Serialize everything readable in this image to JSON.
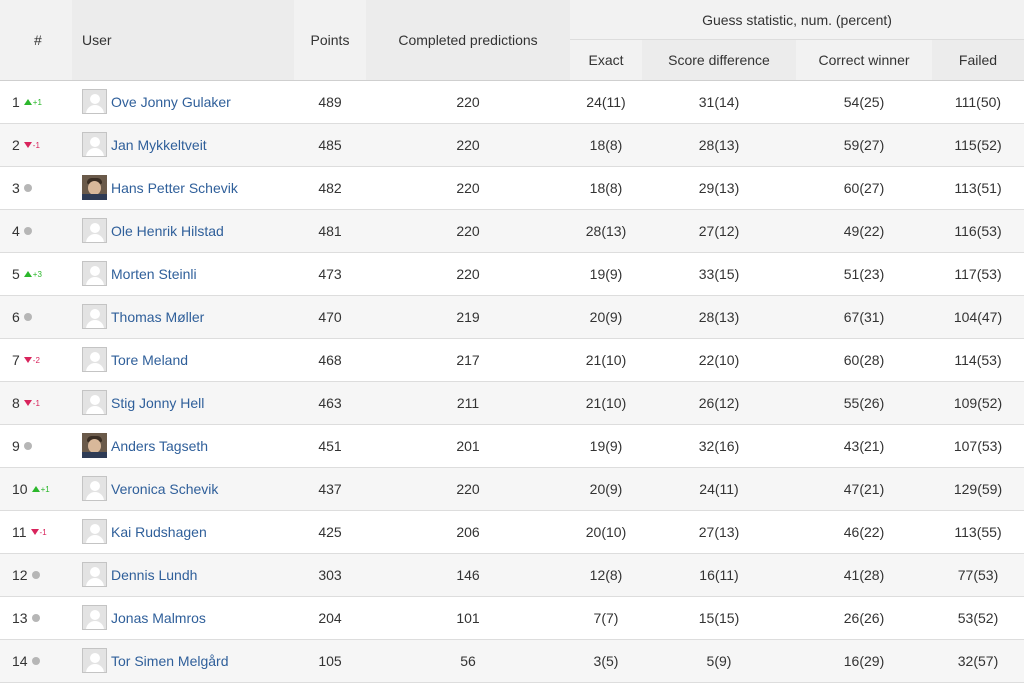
{
  "headers": {
    "rank": "#",
    "user": "User",
    "points": "Points",
    "completed": "Completed predictions",
    "group": "Guess statistic, num. (percent)",
    "exact": "Exact",
    "score_diff": "Score difference",
    "correct_winner": "Correct winner",
    "failed": "Failed"
  },
  "colors": {
    "up": "#2bb72b",
    "down": "#d8245c",
    "same": "#b6b6b6",
    "link": "#2f5f9a"
  },
  "rows": [
    {
      "rank": "1",
      "trend": "up",
      "delta": "+1",
      "avatar": "generic-avatar-icon",
      "name": "Ove Jonny Gulaker",
      "points": "489",
      "completed": "220",
      "exact": "24(11)",
      "score_diff": "31(14)",
      "correct_winner": "54(25)",
      "failed": "111(50)"
    },
    {
      "rank": "2",
      "trend": "down",
      "delta": "-1",
      "avatar": "generic-avatar-icon",
      "name": "Jan Mykkeltveit",
      "points": "485",
      "completed": "220",
      "exact": "18(8)",
      "score_diff": "28(13)",
      "correct_winner": "59(27)",
      "failed": "115(52)"
    },
    {
      "rank": "3",
      "trend": "same",
      "delta": "",
      "avatar": "photo-avatar",
      "name": "Hans Petter Schevik",
      "points": "482",
      "completed": "220",
      "exact": "18(8)",
      "score_diff": "29(13)",
      "correct_winner": "60(27)",
      "failed": "113(51)"
    },
    {
      "rank": "4",
      "trend": "same",
      "delta": "",
      "avatar": "generic-avatar-icon",
      "name": "Ole Henrik Hilstad",
      "points": "481",
      "completed": "220",
      "exact": "28(13)",
      "score_diff": "27(12)",
      "correct_winner": "49(22)",
      "failed": "116(53)"
    },
    {
      "rank": "5",
      "trend": "up",
      "delta": "+3",
      "avatar": "generic-avatar-icon",
      "name": "Morten Steinli",
      "points": "473",
      "completed": "220",
      "exact": "19(9)",
      "score_diff": "33(15)",
      "correct_winner": "51(23)",
      "failed": "117(53)"
    },
    {
      "rank": "6",
      "trend": "same",
      "delta": "",
      "avatar": "generic-avatar-icon",
      "name": "Thomas Møller",
      "points": "470",
      "completed": "219",
      "exact": "20(9)",
      "score_diff": "28(13)",
      "correct_winner": "67(31)",
      "failed": "104(47)"
    },
    {
      "rank": "7",
      "trend": "down",
      "delta": "-2",
      "avatar": "generic-avatar-icon",
      "name": "Tore Meland",
      "points": "468",
      "completed": "217",
      "exact": "21(10)",
      "score_diff": "22(10)",
      "correct_winner": "60(28)",
      "failed": "114(53)"
    },
    {
      "rank": "8",
      "trend": "down",
      "delta": "-1",
      "avatar": "generic-avatar-icon",
      "name": "Stig Jonny Hell",
      "points": "463",
      "completed": "211",
      "exact": "21(10)",
      "score_diff": "26(12)",
      "correct_winner": "55(26)",
      "failed": "109(52)"
    },
    {
      "rank": "9",
      "trend": "same",
      "delta": "",
      "avatar": "photo-avatar",
      "name": "Anders Tagseth",
      "points": "451",
      "completed": "201",
      "exact": "19(9)",
      "score_diff": "32(16)",
      "correct_winner": "43(21)",
      "failed": "107(53)"
    },
    {
      "rank": "10",
      "trend": "up",
      "delta": "+1",
      "avatar": "generic-avatar-icon",
      "name": "Veronica Schevik",
      "points": "437",
      "completed": "220",
      "exact": "20(9)",
      "score_diff": "24(11)",
      "correct_winner": "47(21)",
      "failed": "129(59)"
    },
    {
      "rank": "11",
      "trend": "down",
      "delta": "-1",
      "avatar": "generic-avatar-icon",
      "name": "Kai Rudshagen",
      "points": "425",
      "completed": "206",
      "exact": "20(10)",
      "score_diff": "27(13)",
      "correct_winner": "46(22)",
      "failed": "113(55)"
    },
    {
      "rank": "12",
      "trend": "same",
      "delta": "",
      "avatar": "generic-avatar-icon",
      "name": "Dennis Lundh",
      "points": "303",
      "completed": "146",
      "exact": "12(8)",
      "score_diff": "16(11)",
      "correct_winner": "41(28)",
      "failed": "77(53)"
    },
    {
      "rank": "13",
      "trend": "same",
      "delta": "",
      "avatar": "generic-avatar-icon",
      "name": "Jonas Malmros",
      "points": "204",
      "completed": "101",
      "exact": "7(7)",
      "score_diff": "15(15)",
      "correct_winner": "26(26)",
      "failed": "53(52)"
    },
    {
      "rank": "14",
      "trend": "same",
      "delta": "",
      "avatar": "generic-avatar-icon",
      "name": "Tor Simen Melgård",
      "points": "105",
      "completed": "56",
      "exact": "3(5)",
      "score_diff": "5(9)",
      "correct_winner": "16(29)",
      "failed": "32(57)"
    }
  ]
}
